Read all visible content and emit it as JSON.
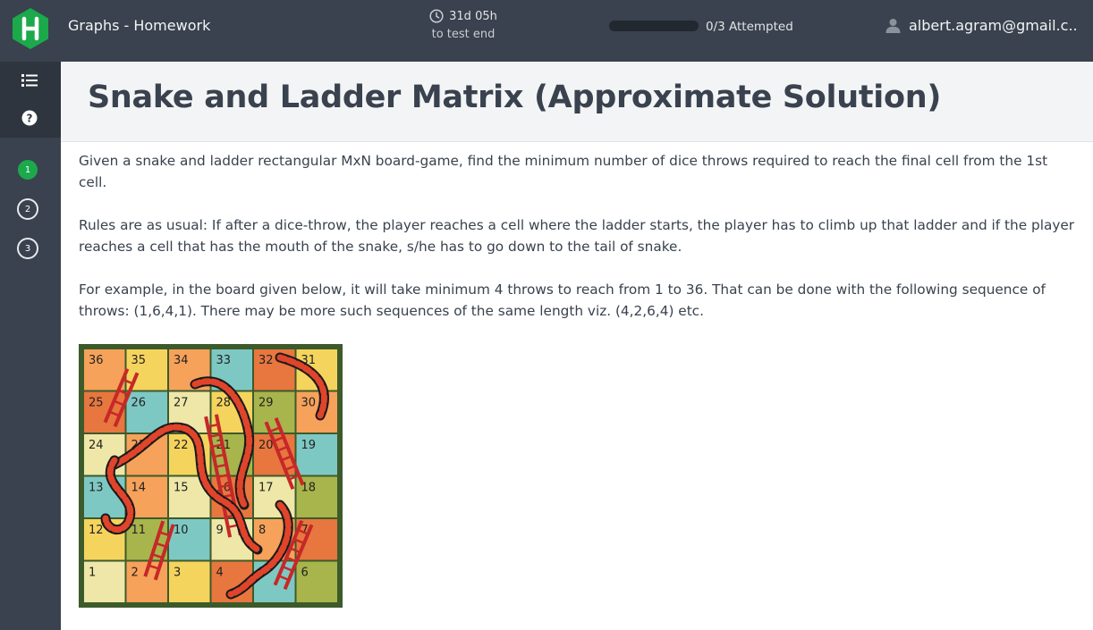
{
  "header": {
    "app_title": "Graphs - Homework",
    "timer_value": "31d 05h",
    "timer_label": "to test end",
    "progress_fraction": 0,
    "progress_text": "0/3 Attempted",
    "user_email": "albert.agram@gmail.c..."
  },
  "sidebar": {
    "questions": [
      "1",
      "2",
      "3"
    ],
    "active_question": "1"
  },
  "challenge": {
    "title": "Snake and Ladder Matrix (Approximate Solution)",
    "paragraphs": [
      "Given a snake and ladder rectangular MxN board-game, find the minimum number of dice throws required to reach the final cell from the 1st cell.",
      "Rules are as usual: If after a dice-throw, the player reaches a cell where the ladder starts, the player has to climb up that ladder and if the player reaches a cell that has the mouth of the snake, s/he has to go down to the tail of snake.",
      "For example, in the board given below, it will take minimum 4 throws to reach from 1 to 36. That can be done with the following sequence of throws: (1,6,4,1). There may be more such sequences of the same length viz. (4,2,6,4) etc."
    ]
  },
  "board": {
    "rows": [
      [
        "36",
        "35",
        "34",
        "33",
        "32",
        "31"
      ],
      [
        "25",
        "26",
        "27",
        "28",
        "29",
        "30"
      ],
      [
        "24",
        "23",
        "22",
        "21",
        "20",
        "19"
      ],
      [
        "13",
        "14",
        "15",
        "16",
        "17",
        "18"
      ],
      [
        "12",
        "11",
        "10",
        "9",
        "8",
        "7"
      ],
      [
        "1",
        "2",
        "3",
        "4",
        "5",
        "6"
      ]
    ],
    "colors": [
      [
        "#f6a25a",
        "#f5d45e",
        "#f6a25a",
        "#7ec8c4",
        "#e8763f",
        "#f5d45e"
      ],
      [
        "#e8763f",
        "#7ec8c4",
        "#eee7a8",
        "#f5d45e",
        "#a8b44c",
        "#f6a25a"
      ],
      [
        "#eee7a8",
        "#f6a25a",
        "#f5d45e",
        "#a8b44c",
        "#e8763f",
        "#7ec8c4"
      ],
      [
        "#7ec8c4",
        "#f6a25a",
        "#eee7a8",
        "#e8763f",
        "#eee7a8",
        "#a8b44c"
      ],
      [
        "#f5d45e",
        "#a8b44c",
        "#7ec8c4",
        "#eee7a8",
        "#f6a25a",
        "#e8763f"
      ],
      [
        "#eee7a8",
        "#f6a25a",
        "#f5d45e",
        "#e8763f",
        "#7ec8c4",
        "#a8b44c"
      ]
    ],
    "border_color": "#3d5a2a"
  },
  "colors": {
    "brand_green": "#1ba94c",
    "topbar": "#39424e"
  }
}
